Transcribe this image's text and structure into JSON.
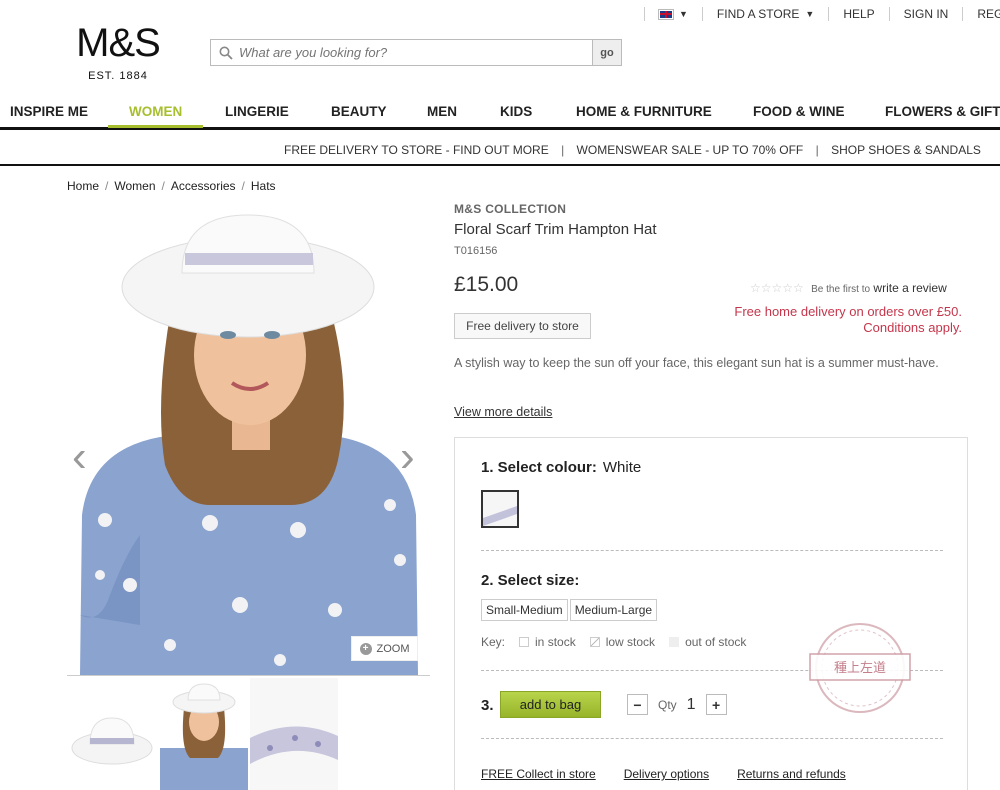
{
  "utility_bar": {
    "find_store": "FIND A STORE",
    "help": "HELP",
    "sign_in": "SIGN IN",
    "register": "REGISTER"
  },
  "logo": {
    "mark": "M&S",
    "est": "EST. 1884"
  },
  "search": {
    "placeholder": "What are you looking for?",
    "go": "go"
  },
  "nav": {
    "items": [
      "INSPIRE ME",
      "WOMEN",
      "LINGERIE",
      "BEAUTY",
      "MEN",
      "KIDS",
      "HOME & FURNITURE",
      "FOOD & WINE",
      "FLOWERS & GIFTS"
    ],
    "active": "WOMEN",
    "accent": "#a7bf2f"
  },
  "promo": {
    "items": [
      "FREE DELIVERY TO STORE - FIND OUT MORE",
      "WOMENSWEAR SALE - UP TO 70% OFF",
      "SHOP SHOES & SANDALS"
    ],
    "separator": "|"
  },
  "breadcrumb": [
    "Home",
    "Women",
    "Accessories",
    "Hats"
  ],
  "image_controls": {
    "zoom": "ZOOM"
  },
  "product": {
    "brand": "M&S COLLECTION",
    "title": "Floral Scarf Trim Hampton Hat",
    "code": "T016156",
    "price": "£15.00",
    "review_prompt": "Be the first to",
    "review_link": "write a review",
    "delivery_note_1": "Free home delivery on orders over £50.",
    "delivery_note_2": "Conditions apply.",
    "free_delivery_btn": "Free delivery to store",
    "description": "A stylish way to keep the sun off your face, this elegant sun hat is a summer must-have.",
    "view_more": "View more details"
  },
  "selection": {
    "colour_label": "1. Select colour:",
    "colour_value": "White",
    "size_label": "2. Select size:",
    "sizes": [
      "Small-Medium",
      "Medium-Large"
    ],
    "key_label": "Key:",
    "key_in": "in stock",
    "key_low": "low stock",
    "key_out": "out of stock",
    "step3": "3.",
    "add_to_bag": "add to bag",
    "qty_label": "Qty",
    "qty_value": "1",
    "minus": "−",
    "plus": "+"
  },
  "footer_links": [
    "FREE Collect in store",
    "Delivery options",
    "Returns and refunds"
  ],
  "stamp_text": "種上左道",
  "colors": {
    "accent_green": "#a7bf2f",
    "delivery_red": "#c4364b",
    "add_bag_green": "#a8c63c"
  }
}
